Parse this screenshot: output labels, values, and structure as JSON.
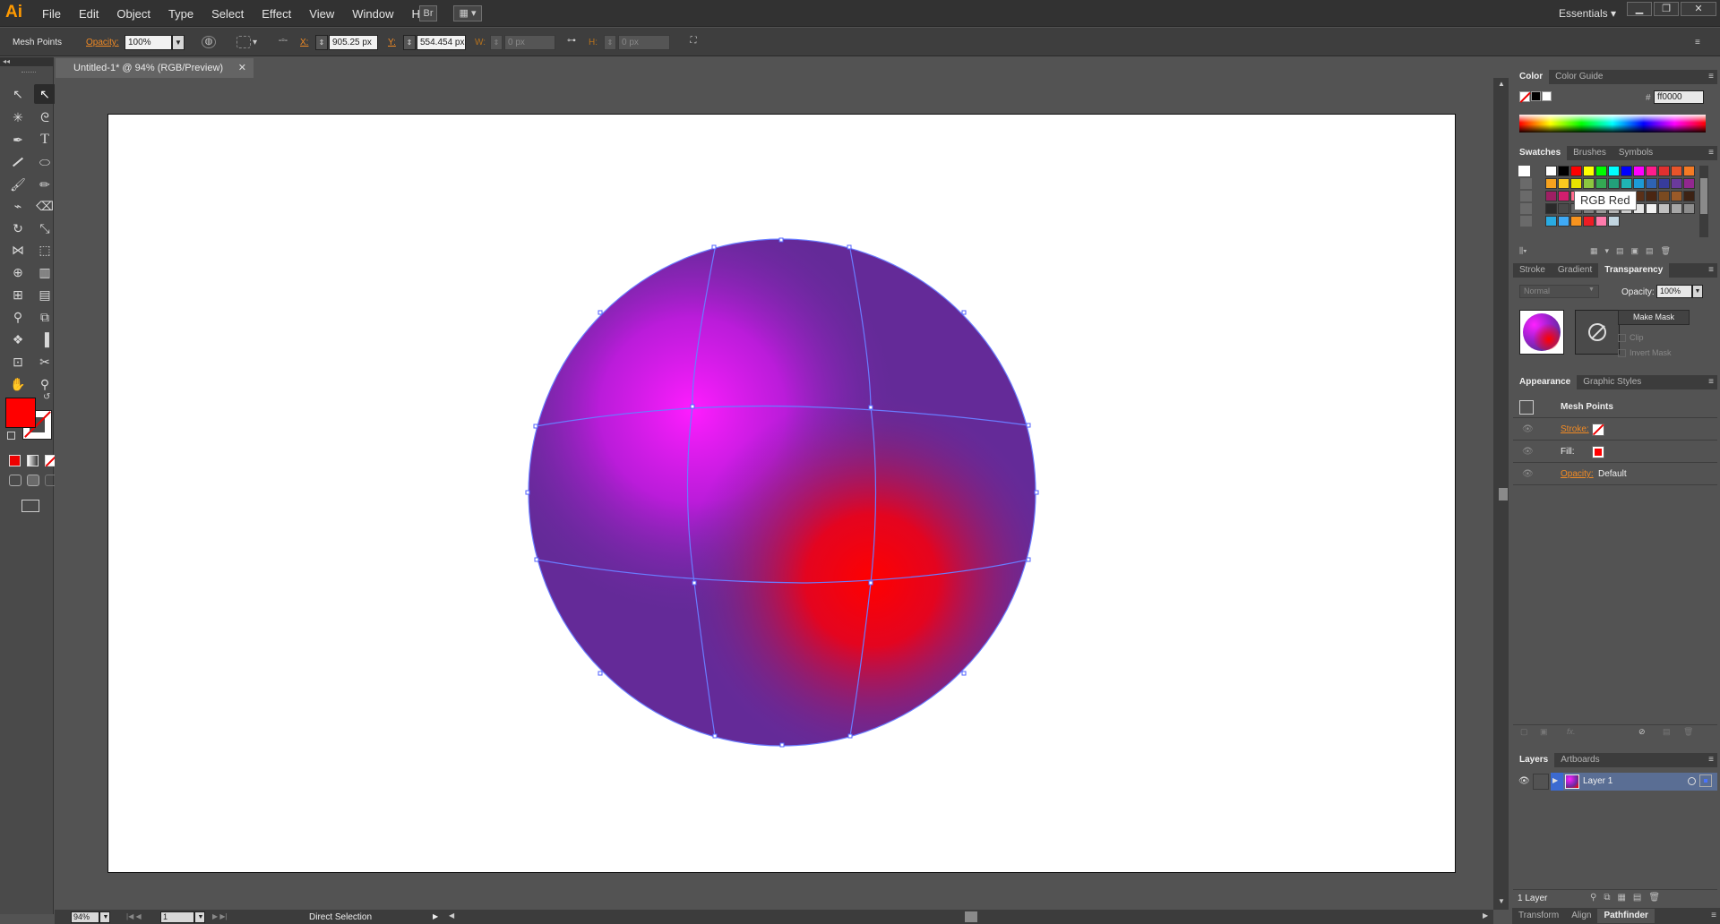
{
  "app": {
    "logo": "Ai"
  },
  "menu": [
    "File",
    "Edit",
    "Object",
    "Type",
    "Select",
    "Effect",
    "View",
    "Window",
    "Help"
  ],
  "menubar_icons": {
    "bridge": "Br",
    "arrange": "▦ ▾"
  },
  "workspace": "Essentials ▾",
  "window_buttons": {
    "minimize": "▁",
    "restore": "❐",
    "close": "✕"
  },
  "control_bar": {
    "selection_label": "Mesh Points",
    "opacity_label": "Opacity:",
    "opacity_value": "100%",
    "x_label": "X:",
    "x_value": "905.25 px",
    "y_label": "Y:",
    "y_value": "554.454 px",
    "w_label": "W:",
    "w_value": "0 px",
    "h_label": "H:",
    "h_value": "0 px"
  },
  "document": {
    "tab_title": "Untitled-1* @ 94% (RGB/Preview)",
    "close": "✕"
  },
  "status_bar": {
    "zoom": "94%",
    "artboard_number": "1",
    "tool_name": "Direct Selection"
  },
  "color_panel": {
    "tabs": [
      "Color",
      "Color Guide"
    ],
    "hex_label": "#",
    "hex_value": "ff0000"
  },
  "swatches_panel": {
    "tabs": [
      "Swatches",
      "Brushes",
      "Symbols"
    ],
    "tooltip": "RGB Red",
    "rows": [
      [
        "#ffffff",
        "#000000",
        "#ff0000",
        "#ffff00",
        "#00ff00",
        "#00ffff",
        "#0000ff",
        "#ff00ff",
        "#ff1c8c",
        "#e03030",
        "#e8542a",
        "#f47a24"
      ],
      [
        "#f6a21e",
        "#f9c81f",
        "#e8e300",
        "#8cc63f",
        "#34a853",
        "#22a07a",
        "#1fb5b5",
        "#1c9ad6",
        "#2e63b4",
        "#373c9c",
        "#6a3a9c",
        "#92278f"
      ],
      [
        "#9e1f63",
        "#d21e6e",
        "#ff6a8c",
        "#c8a2a2",
        "#a07a5a",
        "#7e5a3c",
        "#6a4228",
        "#5a3018",
        "#4a2612",
        "#7a4a20",
        "#9a5a28",
        "#3c2214"
      ],
      [
        "#2a2a2a",
        "#4a4a4a",
        "#666666",
        "#808080",
        "#999999",
        "#b3b3b3",
        "#cccccc",
        "#e6e6e6",
        "#f2f2f2",
        "#bfbfbf",
        "#a6a6a6",
        "#8c8c8c"
      ],
      [
        "#29abe2",
        "#3fa9f5",
        "#f7931e",
        "#ed1c24",
        "#ff7bac",
        "#c1d5e0"
      ]
    ]
  },
  "transparency_panel": {
    "tabs": [
      "Stroke",
      "Gradient",
      "Transparency"
    ],
    "blend_mode": "Normal",
    "opacity_label": "Opacity:",
    "opacity_value": "100%",
    "make_mask": "Make Mask",
    "clip": "Clip",
    "invert_mask": "Invert Mask"
  },
  "appearance_panel": {
    "tabs": [
      "Appearance",
      "Graphic Styles"
    ],
    "title": "Mesh Points",
    "stroke_label": "Stroke:",
    "fill_label": "Fill:",
    "opacity_label": "Opacity:",
    "opacity_value": "Default",
    "fill_color": "#ff0000",
    "footer_icons": [
      "square-icon",
      "square-icon",
      "fx-icon",
      "no-icon",
      "duplicate-icon",
      "trash-icon"
    ]
  },
  "layers_panel": {
    "tabs": [
      "Layers",
      "Artboards"
    ],
    "layer_name": "Layer 1",
    "count": "1 Layer"
  },
  "bottom_tabs": [
    "Transform",
    "Align",
    "Pathfinder"
  ],
  "colors": {
    "accent": "#f08a24",
    "fill": "#ff0000",
    "mesh_line": "#6a7cff",
    "sphere_base": "#6a2aa0"
  }
}
